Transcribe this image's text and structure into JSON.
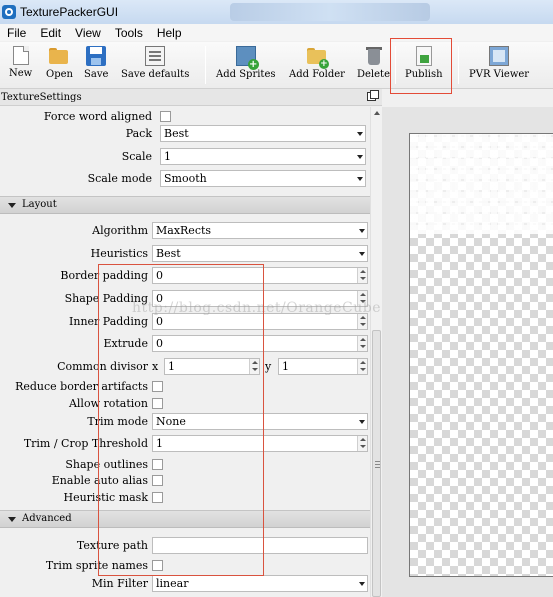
{
  "window": {
    "title": "TexturePackerGUI"
  },
  "menu": [
    "File",
    "Edit",
    "View",
    "Tools",
    "Help"
  ],
  "toolbar": {
    "new": "New",
    "open": "Open",
    "save": "Save",
    "save_defaults": "Save defaults",
    "add_sprites": "Add Sprites",
    "add_folder": "Add Folder",
    "delete": "Delete",
    "publish": "Publish",
    "pvr_viewer": "PVR Viewer"
  },
  "dock": {
    "title": "TextureSettings"
  },
  "settings": {
    "force_word_aligned": {
      "label": "Force word aligned",
      "checked": false
    },
    "pack": {
      "label": "Pack",
      "value": "Best"
    },
    "scale": {
      "label": "Scale",
      "value": "1"
    },
    "scale_mode": {
      "label": "Scale mode",
      "value": "Smooth"
    },
    "layout_section": "Layout",
    "algorithm": {
      "label": "Algorithm",
      "value": "MaxRects"
    },
    "heuristics": {
      "label": "Heuristics",
      "value": "Best"
    },
    "border_padding": {
      "label": "Border padding",
      "value": "0"
    },
    "shape_padding": {
      "label": "Shape Padding",
      "value": "0"
    },
    "inner_padding": {
      "label": "Inner Padding",
      "value": "0"
    },
    "extrude": {
      "label": "Extrude",
      "value": "0"
    },
    "common_divisor": {
      "label": "Common divisor",
      "x_label": "x",
      "x_value": "1",
      "y_label": "y",
      "y_value": "1"
    },
    "reduce_border_artifacts": {
      "label": "Reduce border artifacts",
      "checked": false
    },
    "allow_rotation": {
      "label": "Allow rotation",
      "checked": false
    },
    "trim_mode": {
      "label": "Trim mode",
      "value": "None"
    },
    "trim_crop_threshold": {
      "label": "Trim / Crop Threshold",
      "value": "1"
    },
    "shape_outlines": {
      "label": "Shape outlines",
      "checked": false
    },
    "enable_auto_alias": {
      "label": "Enable auto alias",
      "checked": false
    },
    "heuristic_mask": {
      "label": "Heuristic mask",
      "checked": false
    },
    "advanced_section": "Advanced",
    "texture_path": {
      "label": "Texture path",
      "value": ""
    },
    "trim_sprite_names": {
      "label": "Trim sprite names",
      "checked": false
    },
    "min_filter": {
      "label": "Min Filter",
      "value": "linear"
    }
  },
  "watermark": "http://blog.csdn.net/OrangeCube",
  "colors": {
    "highlight": "#e34b37",
    "titlebar": "#c6d9f0"
  }
}
